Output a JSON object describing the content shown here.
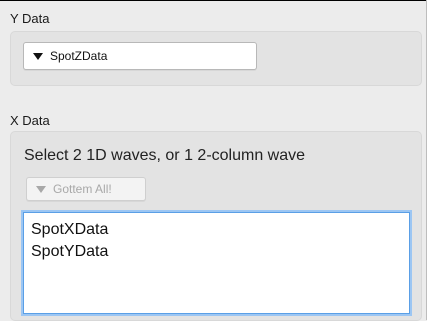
{
  "y_data": {
    "label": "Y Data",
    "popup_value": "SpotZData"
  },
  "x_data": {
    "label": "X Data",
    "instruction": "Select 2 1D waves, or 1 2-column wave",
    "gottem_all_label": "Gottem All!",
    "waves": [
      "SpotXData",
      "SpotYData"
    ]
  }
}
